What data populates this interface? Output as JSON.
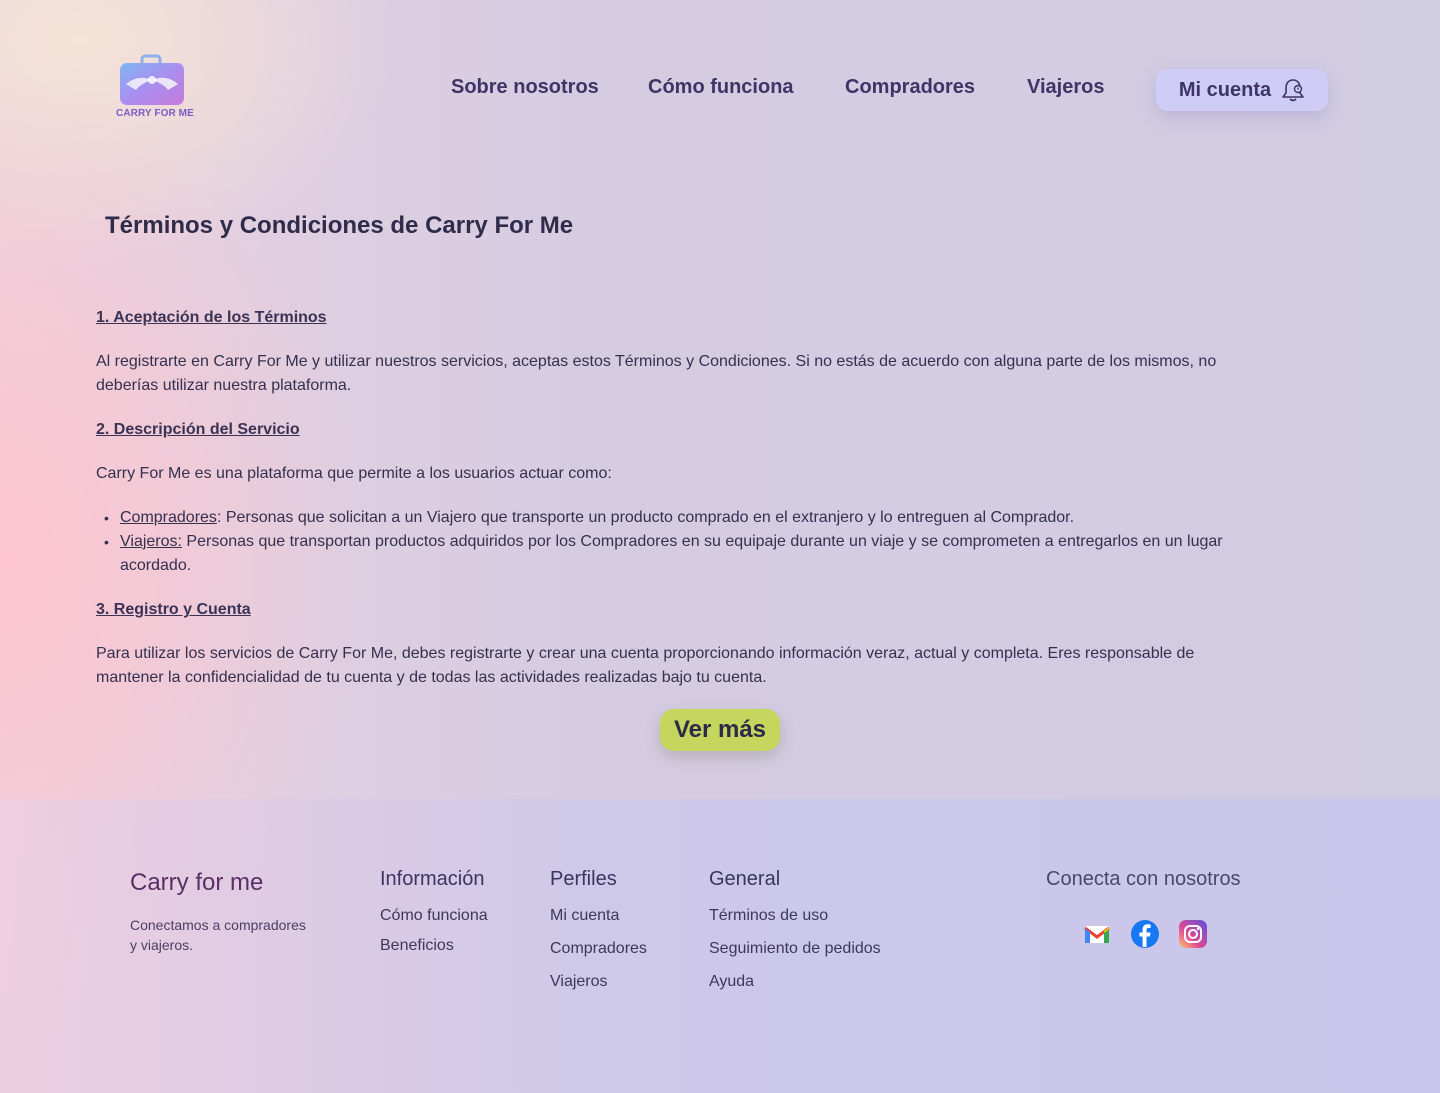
{
  "brand": {
    "logo_text": "CARRY FOR ME"
  },
  "nav": {
    "items": [
      "Sobre nosotros",
      "Cómo funciona",
      "Compradores",
      "Viajeros"
    ],
    "account_label": "Mi cuenta"
  },
  "page": {
    "title": "Términos y Condiciones de Carry For Me",
    "sections": [
      {
        "heading": "1. Aceptación de los Términos",
        "text": "Al registrarte en Carry For Me y utilizar nuestros servicios, aceptas estos Términos y Condiciones. Si no estás de acuerdo con alguna parte de los mismos, no deberías utilizar nuestra plataforma."
      },
      {
        "heading": "2. Descripción del Servicio",
        "text": "Carry For Me es una plataforma que permite a los usuarios actuar como:",
        "items": [
          {
            "term": "Compradores",
            "sep": ":",
            "desc": " Personas que solicitan a un Viajero que transporte un producto comprado en el extranjero y lo entreguen al Comprador."
          },
          {
            "term": "Viajeros:",
            "sep": "",
            "desc": " Personas que transportan productos adquiridos por los Compradores en su equipaje durante un viaje y se comprometen a entregarlos en un lugar acordado."
          }
        ]
      },
      {
        "heading": "3. Registro y Cuenta",
        "text": "Para utilizar los servicios de Carry For Me, debes registrarte y crear una cuenta proporcionando información veraz, actual y completa. Eres responsable de mantener la confidencialidad de tu cuenta y de todas las actividades realizadas bajo tu cuenta."
      }
    ],
    "more_button": "Ver más"
  },
  "footer": {
    "brand": "Carry for me",
    "tagline": "Conectamos a compradores y viajeros.",
    "columns": [
      {
        "title": "Información",
        "links": [
          "Cómo funciona",
          "Beneficios"
        ]
      },
      {
        "title": "Perfiles",
        "links": [
          "Mi cuenta",
          "Compradores",
          "Viajeros"
        ]
      },
      {
        "title": "General",
        "links": [
          "Términos de uso",
          "Seguimiento de pedidos",
          "Ayuda"
        ]
      }
    ],
    "social_title": "Conecta con nosotros",
    "social_icons": [
      "gmail-icon",
      "facebook-icon",
      "instagram-icon"
    ]
  },
  "colors": {
    "accent_button": "#c4d65d",
    "account_button": "#cfcdf6",
    "brand_purple": "#7b5cc4"
  }
}
